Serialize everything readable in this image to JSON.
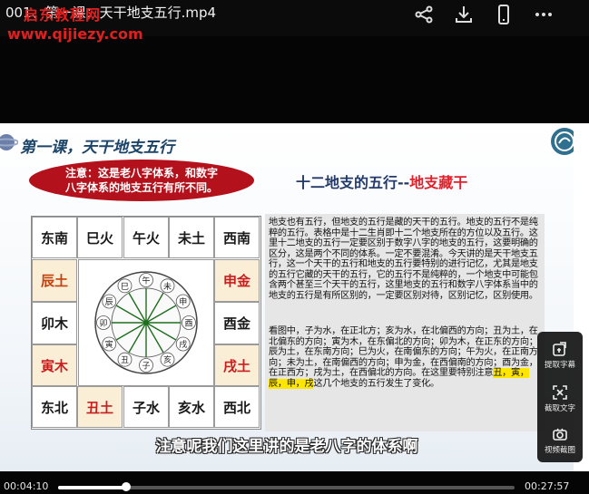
{
  "topbar": {
    "title": "001、第一课：天干地支五行.mp4",
    "watermark_1": "启东教程网",
    "watermark_2": "www.qijiezy.com",
    "icons": [
      "share-icon",
      "download-icon",
      "phone-icon",
      "more-icon"
    ]
  },
  "slide": {
    "lesson": "第一课，天干地支五行",
    "notice_line1": "注意：这是老八字体系，和数字",
    "notice_line2": "八字体系的地支五行有所不同。",
    "header_prefix": "十二地支的五行--",
    "header_highlight": "地支藏干",
    "grid": {
      "top": [
        "东南",
        "巳火",
        "午火",
        "未土",
        "西南"
      ],
      "left": [
        "辰土",
        "卯木",
        "寅木"
      ],
      "right": [
        "申金",
        "酉金",
        "戌土"
      ],
      "bottom": [
        "东北",
        "丑土",
        "子水",
        "亥水",
        "西北"
      ],
      "wheel_labels": [
        "午",
        "未",
        "申",
        "酉",
        "戌",
        "亥",
        "子",
        "丑",
        "寅",
        "卯",
        "辰",
        "巳"
      ]
    },
    "para1": "地支也有五行，但地支的五行是藏的天干的五行。地支的五行不是纯粹的五行。表格中是十二生肖即十二个地支所在的方位以及五行。这里十二地支的五行一定要区别于数字八字的地支的五行，这要明确的区分，这是两个不同的体系。一定不要混淆。今天讲的是天干地支五行，这一个天干的五行和地支的五行要特别的进行记忆，尤其是地支的五行它藏的天干的五行，它的五行不是纯粹的，一个地支中可能包含两个甚至三个天干的五行，这里地支的五行和数字八字体系当中的地支的五行是有所区别的，一定要区别对待，区别记忆，区别使用。",
    "para2_a": "看图中，子为水，在正北方；亥为水，在北偏西的方向；丑为土，在北偏东的方向；寅为木，在东偏北的方向；卯为木，在正东的方向；辰为土，在东南方向；巳为火，在南偏东的方向；午为火，在正南方向；未为土，在南偏西的方向；申为金，在西偏南的方向；酉为金，在正西方；戌为土，在西偏北的方向。在这里要特别注意",
    "para2_hl": "丑，寅，辰，申，戌",
    "para2_b": "这几个地支的五行发生了变化。",
    "subtitle": "注意呢我们这里讲的是老八字的体系啊"
  },
  "panel": {
    "items": [
      {
        "label": "提取字幕",
        "icon": "extract-subtitle-icon"
      },
      {
        "label": "截取文字",
        "icon": "capture-text-icon"
      },
      {
        "label": "视频截图",
        "icon": "screenshot-icon"
      }
    ]
  },
  "player": {
    "current_time": "00:04:10",
    "total_time": "00:27:57",
    "progress": 0.149
  },
  "colors": {
    "accent_red": "#e0202a",
    "navy": "#233a6a",
    "fire": "#c81e1e",
    "wood": "#1e6e1e",
    "earth": "#c2410c",
    "metal": "#1a1a1a",
    "water": "#1a1a1a"
  }
}
